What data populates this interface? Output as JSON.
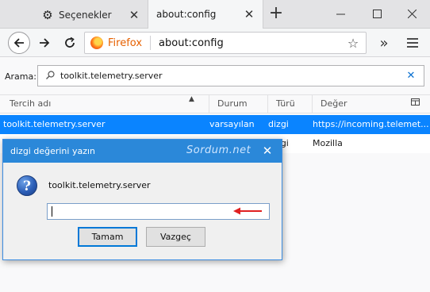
{
  "tabs": [
    {
      "label": "Seçenekler",
      "icon": "gear-icon"
    },
    {
      "label": "about:config",
      "icon": ""
    }
  ],
  "window_controls": {
    "minimize": "—",
    "maximize": "☐",
    "close": "✕"
  },
  "urlbar": {
    "identity": "Firefox",
    "url": "about:config"
  },
  "search": {
    "label": "Arama:",
    "value": "toolkit.telemetry.server"
  },
  "table": {
    "columns": [
      "Tercih adı",
      "Durum",
      "Türü",
      "Değer"
    ],
    "rows": [
      {
        "name": "toolkit.telemetry.server",
        "status": "varsayılan",
        "type": "dizgi",
        "value": "https://incoming.telemet..."
      },
      {
        "name": "",
        "status": "",
        "type": "dizgi",
        "value": "Mozilla"
      }
    ]
  },
  "dialog": {
    "title": "dizgi değerini yazın",
    "watermark": "Sordum.net",
    "message": "toolkit.telemetry.server",
    "input_value": "",
    "ok_label": "Tamam",
    "cancel_label": "Vazgeç"
  },
  "colors": {
    "selection": "#0a84ff",
    "dialog_title": "#2b88d9",
    "annotation_arrow": "#e02020"
  }
}
